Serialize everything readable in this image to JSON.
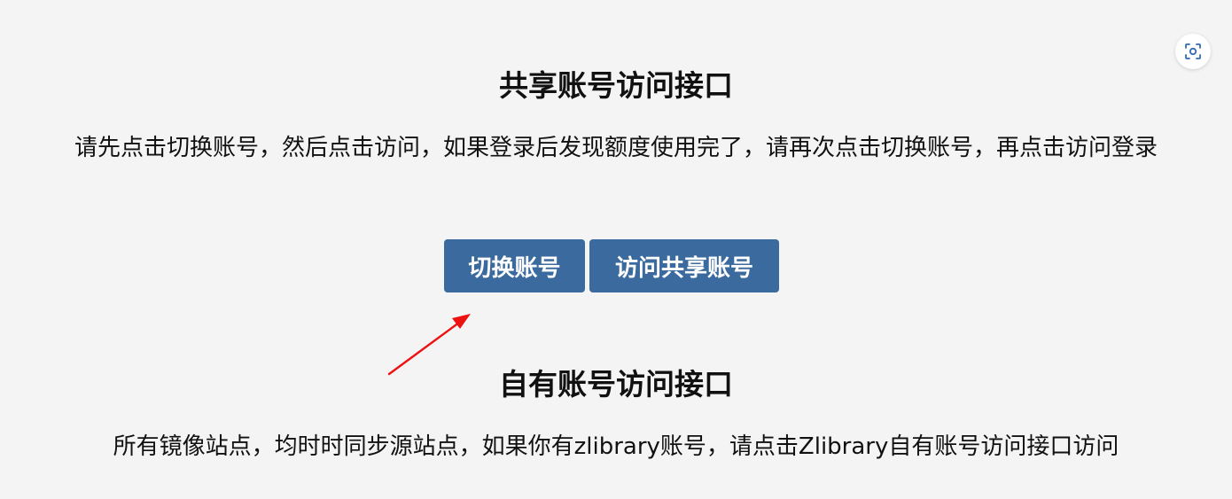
{
  "lens_button": {
    "icon": "lens-icon"
  },
  "shared_section": {
    "title": "共享账号访问接口",
    "description": "请先点击切换账号，然后点击访问，如果登录后发现额度使用完了，请再次点击切换账号，再点击访问登录"
  },
  "buttons": {
    "switch_account": "切换账号",
    "visit_shared": "访问共享账号"
  },
  "annotation": {
    "icon": "red-arrow-icon",
    "color": "#ee1111"
  },
  "own_section": {
    "title": "自有账号访问接口",
    "description": "所有镜像站点，均时时同步源站点，如果你有zlibrary账号，请点击Zlibrary自有账号访问接口访问"
  },
  "colors": {
    "background": "#f4f4f4",
    "button": "#3a6a9e",
    "button_text": "#ffffff"
  }
}
